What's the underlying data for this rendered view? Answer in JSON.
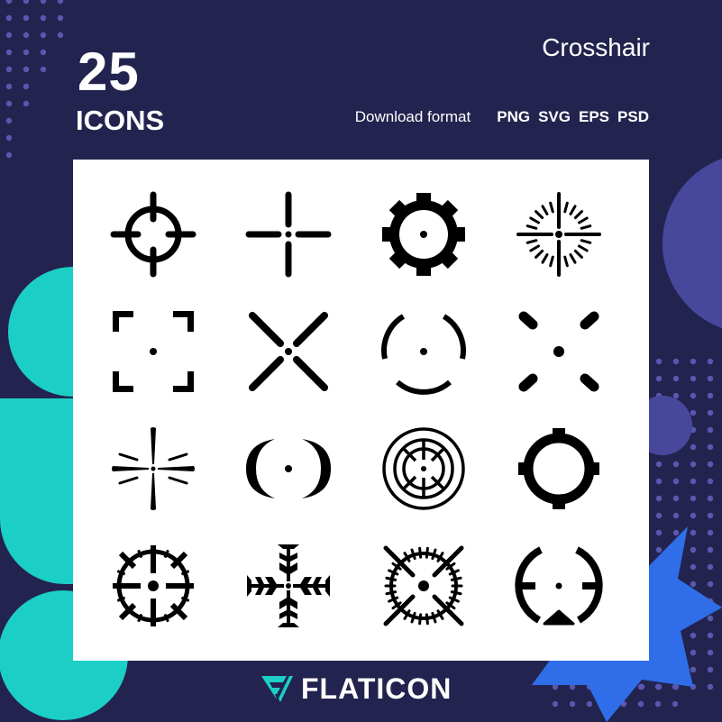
{
  "header": {
    "count": "25",
    "count_label": "ICONS",
    "pack_name": "Crosshair",
    "download_label": "Download format",
    "formats": [
      "PNG",
      "SVG",
      "EPS",
      "PSD"
    ]
  },
  "colors": {
    "background": "#23234f",
    "dots": "#5a57b0",
    "teal": "#1ccfc6",
    "violet_circle": "#47489c",
    "blue_star": "#2f6ee8",
    "panel": "#ffffff",
    "icon": "#000000"
  },
  "icons": [
    {
      "name": "crosshair-circle-icon"
    },
    {
      "name": "crosshair-plus-icon"
    },
    {
      "name": "crosshair-gear-icon"
    },
    {
      "name": "crosshair-radial-ticks-icon"
    },
    {
      "name": "crosshair-corner-brackets-icon"
    },
    {
      "name": "crosshair-x-icon"
    },
    {
      "name": "crosshair-broken-ring-icon"
    },
    {
      "name": "crosshair-four-pills-icon"
    },
    {
      "name": "crosshair-star-burst-icon"
    },
    {
      "name": "crosshair-parentheses-icon"
    },
    {
      "name": "crosshair-concentric-rings-icon"
    },
    {
      "name": "crosshair-ring-with-tabs-icon"
    },
    {
      "name": "crosshair-spiked-wheel-icon"
    },
    {
      "name": "crosshair-snowflake-icon"
    },
    {
      "name": "crosshair-graduated-dial-icon"
    },
    {
      "name": "crosshair-triangle-marker-icon"
    }
  ],
  "footer": {
    "brand": "FLATICON"
  }
}
